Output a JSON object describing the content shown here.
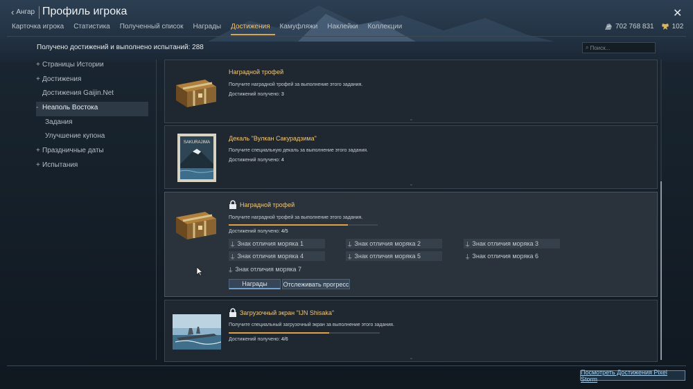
{
  "header": {
    "back_label": "Ангар",
    "title": "Профиль игрока"
  },
  "tabs": [
    {
      "label": "Карточка игрока",
      "active": false
    },
    {
      "label": "Статистика",
      "active": false
    },
    {
      "label": "Полученный список",
      "active": false
    },
    {
      "label": "Награды",
      "active": false
    },
    {
      "label": "Достижения",
      "active": true
    },
    {
      "label": "Камуфляжи",
      "active": false
    },
    {
      "label": "Наклейки",
      "active": false
    },
    {
      "label": "Коллекции",
      "active": false
    }
  ],
  "currency": {
    "silver": "702 768 831",
    "gold": "102"
  },
  "summary": "Получено достижений и выполнено испытаний: 288",
  "search": {
    "placeholder": "Поиск..."
  },
  "sidebar": [
    {
      "prefix": "+",
      "label": "Страницы Истории"
    },
    {
      "prefix": "+",
      "label": "Достижения"
    },
    {
      "prefix": "",
      "label": "Достижения Gaijin.Net"
    },
    {
      "prefix": "-",
      "label": "Неаполь Востока"
    },
    {
      "prefix": "",
      "label": "Задания"
    },
    {
      "prefix": "",
      "label": "Улучшение купона"
    },
    {
      "prefix": "+",
      "label": "Праздничные даты"
    },
    {
      "prefix": "+",
      "label": "Испытания"
    }
  ],
  "cards": [
    {
      "title": "Наградной трофей",
      "desc": "Получите наградной трофей за выполнение этого задания.",
      "count_label": "Достижений получено:",
      "count": "3"
    },
    {
      "title": "Декаль \"Вулкан Сакурадзима\"",
      "desc": "Получите специальную декаль за выполнение этого задания.",
      "count_label": "Достижений получено:",
      "count": "4",
      "decal_text": "SAKURAJIMA"
    },
    {
      "title": "Наградной трофей",
      "desc": "Получите наградной трофей за выполнение этого задания.",
      "count_label": "Достижений получено:",
      "count": "4/5",
      "progress": 0.8,
      "conditions": [
        {
          "label": "Знак отличия моряка 1",
          "done": true
        },
        {
          "label": "Знак отличия моряка 2",
          "done": true
        },
        {
          "label": "Знак отличия моряка 3",
          "done": true
        },
        {
          "label": "Знак отличия моряка 4",
          "done": true
        },
        {
          "label": "Знак отличия моряка 5",
          "done": true
        },
        {
          "label": "Знак отличия моряка 6",
          "done": false
        },
        {
          "label": "Знак отличия моряка 7",
          "done": false
        }
      ],
      "buttons": {
        "rewards": "Награды",
        "track": "Отслеживать прогресс"
      }
    },
    {
      "title": "Загрузочный экран \"IJN Shisaka\"",
      "desc": "Получите специальный загрузочный экран за выполнение этого задания.",
      "count_label": "Достижений получено:",
      "count": "4/6",
      "progress": 0.667
    }
  ],
  "footer_link": "Посмотреть Достижения Pixel Storm",
  "colors": {
    "accent": "#e0a640",
    "link": "#a9d3f2"
  }
}
